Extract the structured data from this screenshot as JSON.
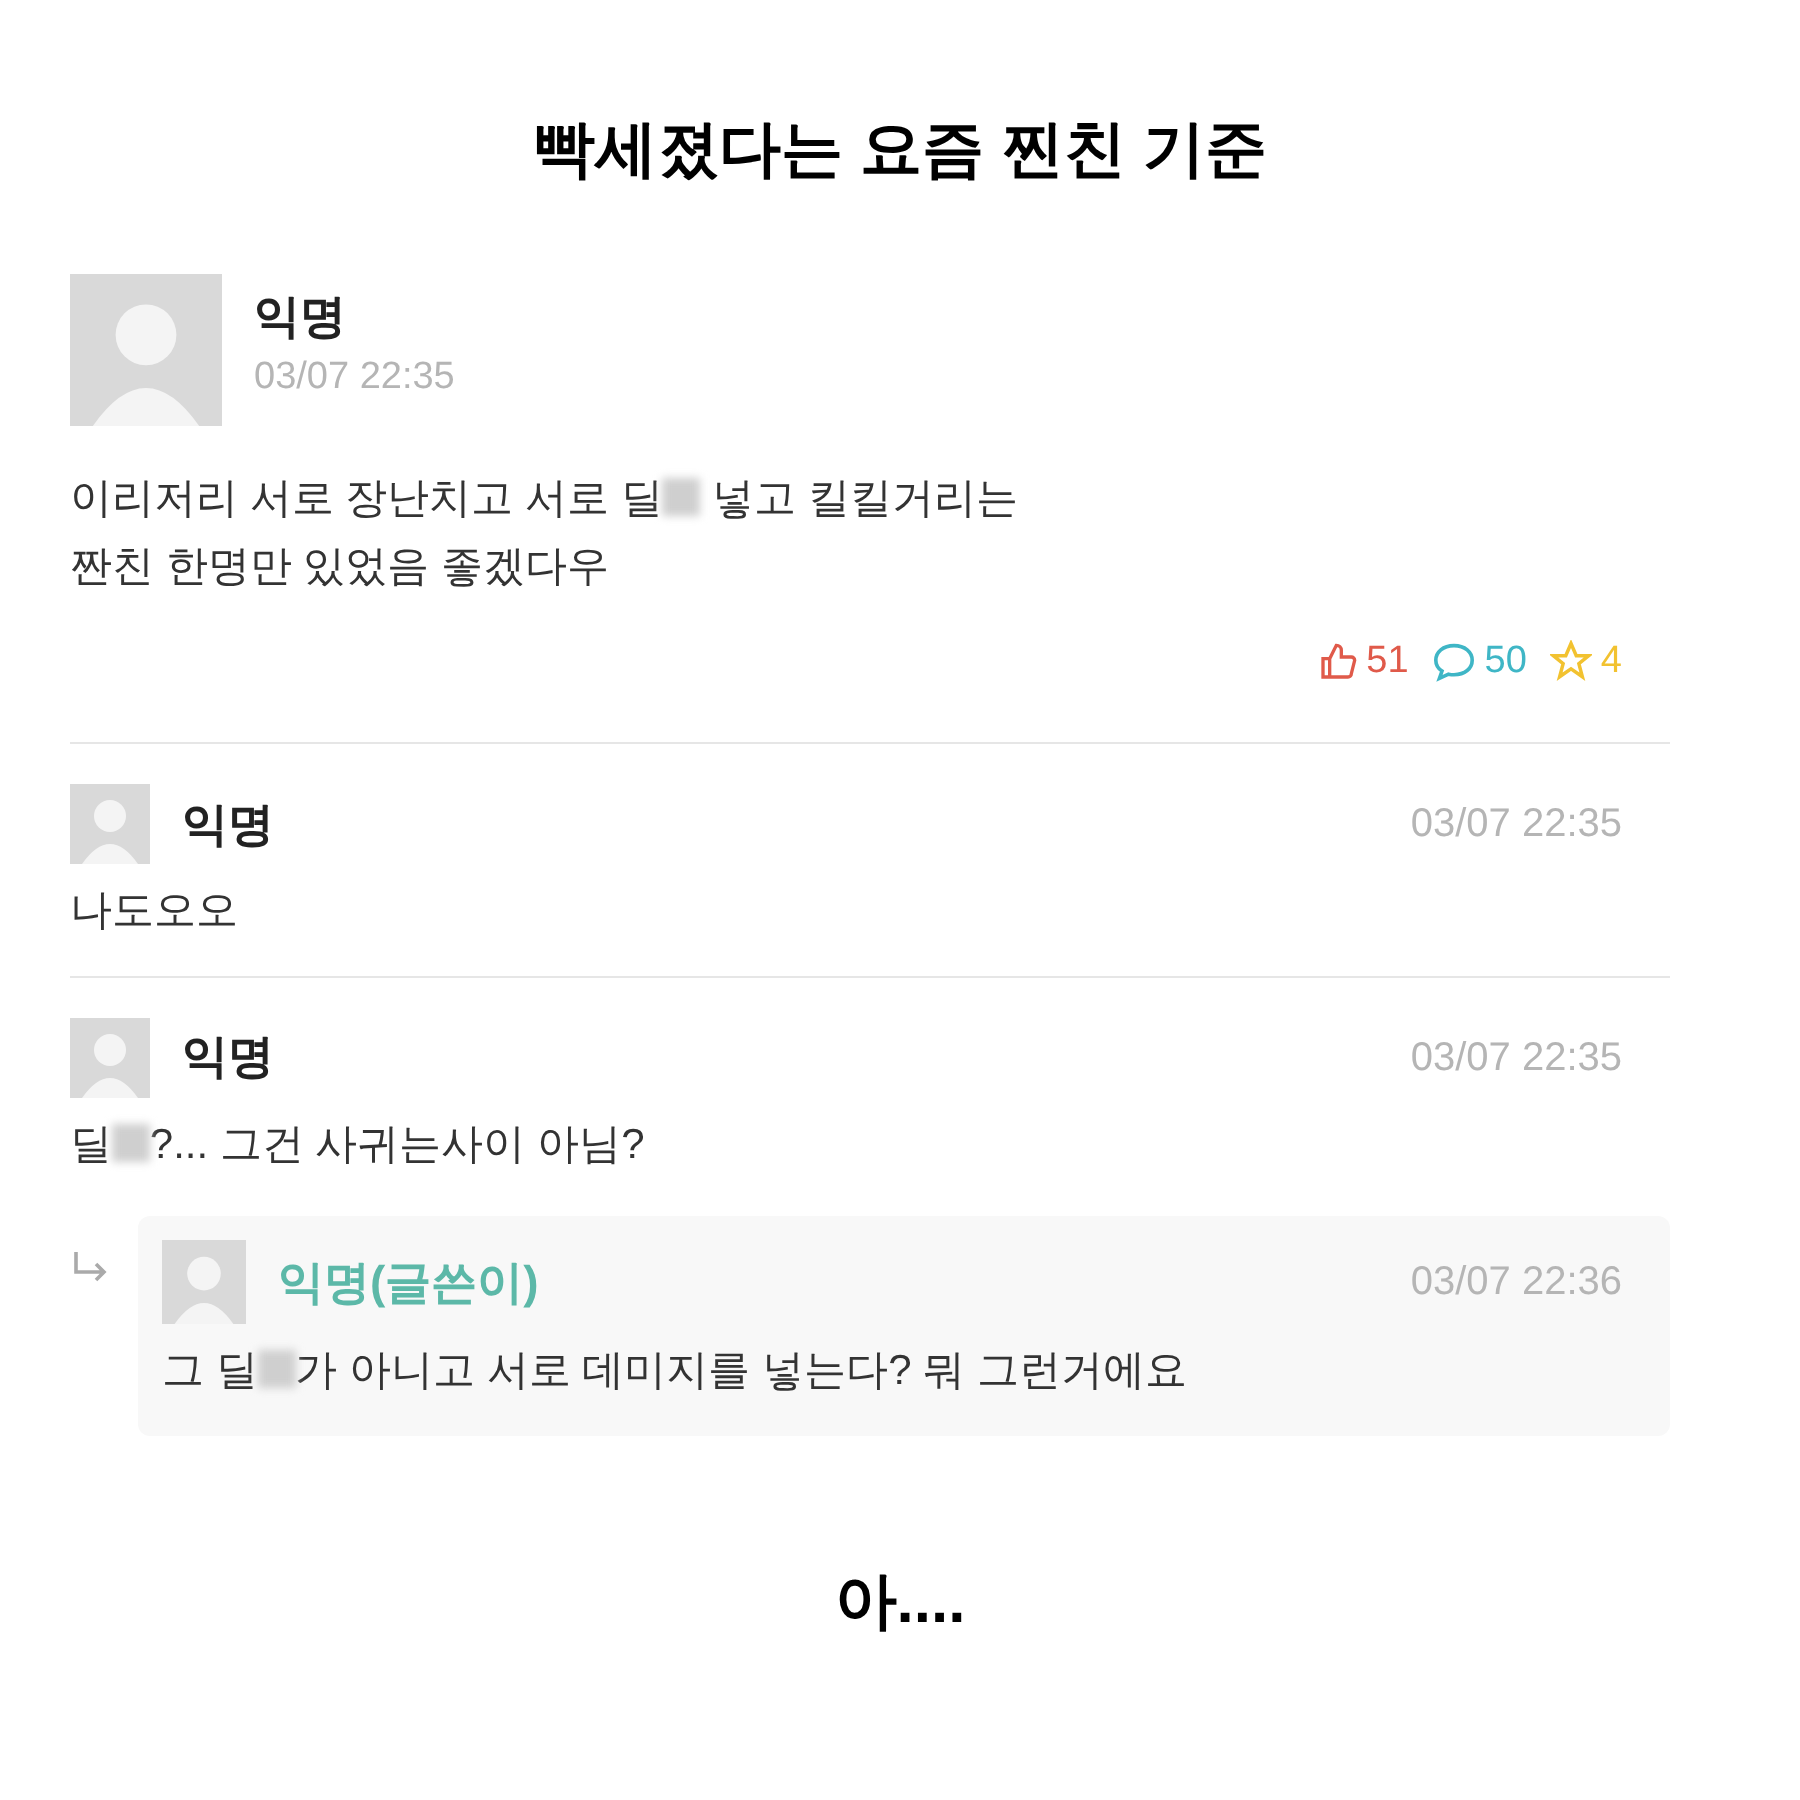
{
  "headline": "빡세졌다는 요즘 찐친 기준",
  "post": {
    "author": "익명",
    "time": "03/07 22:35",
    "body": [
      {
        "kind": "text",
        "text": "이리저리 서로 장난치고 서로 딜"
      },
      {
        "kind": "blur"
      },
      {
        "kind": "text",
        "text": " 넣고 킬킬거리는\n짠친 한명만 있었음 좋겠다우"
      }
    ],
    "likes": "51",
    "comments": "50",
    "scraps": "4"
  },
  "comments": [
    {
      "author": "익명",
      "is_writer": false,
      "reply": false,
      "time": "03/07 22:35",
      "body": [
        {
          "kind": "text",
          "text": "나도오오"
        }
      ]
    },
    {
      "author": "익명",
      "is_writer": false,
      "reply": false,
      "time": "03/07 22:35",
      "body": [
        {
          "kind": "text",
          "text": "딜"
        },
        {
          "kind": "blur"
        },
        {
          "kind": "text",
          "text": "?... 그건 사귀는사이 아님?"
        }
      ]
    },
    {
      "author": "익명(글쓴이)",
      "is_writer": true,
      "reply": true,
      "time": "03/07 22:36",
      "body": [
        {
          "kind": "text",
          "text": "그 딜"
        },
        {
          "kind": "blur"
        },
        {
          "kind": "text",
          "text": "가 아니고 서로 데미지를 넣는다? 뭐 그런거에요"
        }
      ]
    }
  ],
  "caption": "아...."
}
